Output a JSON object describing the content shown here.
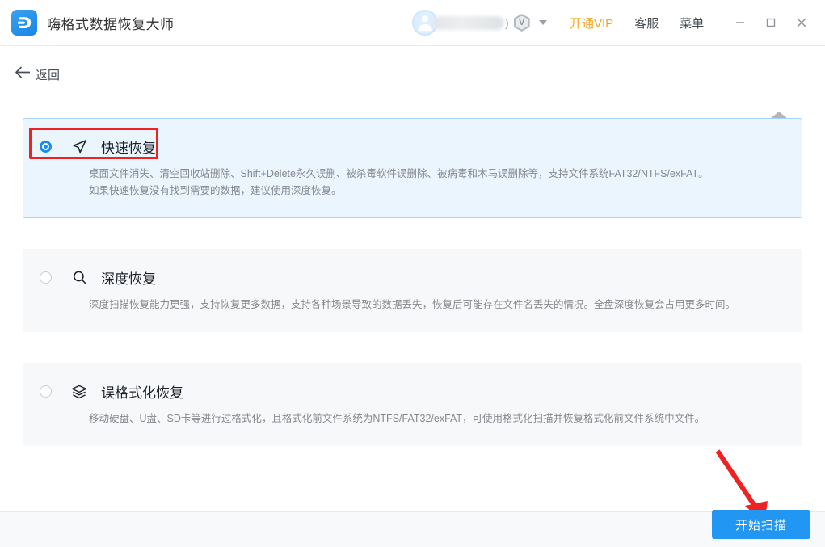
{
  "titlebar": {
    "app_title": "嗨格式数据恢复大师",
    "logo_icon": "app-logo-d-icon",
    "account": {
      "avatar_icon": "user-avatar-icon",
      "username_redacted": "",
      "paren": ")",
      "vip_badge_letter": "V",
      "dropdown_icon": "chevron-down-icon"
    },
    "links": [
      {
        "label": "开通VIP",
        "name": "open-vip-link",
        "accent": "#f5a623"
      },
      {
        "label": "客服",
        "name": "customer-service-link"
      },
      {
        "label": "菜单",
        "name": "menu-link"
      }
    ],
    "window_controls": [
      {
        "name": "minimize-button",
        "icon": "minimize-icon"
      },
      {
        "name": "maximize-button",
        "icon": "maximize-icon"
      },
      {
        "name": "close-button",
        "icon": "close-icon"
      }
    ]
  },
  "subheader": {
    "back_label": "返回",
    "back_icon": "arrow-left-icon",
    "home_icon": "home-icon"
  },
  "options": [
    {
      "id": "quick-recovery",
      "title": "快速恢复",
      "icon": "navigation-arrow-icon",
      "selected": true,
      "desc_line1": "桌面文件消失、清空回收站删除、Shift+Delete永久误删、被杀毒软件误删除、被病毒和木马误删除等，支持文件系统FAT32/NTFS/exFAT。",
      "desc_line2": "如果快速恢复没有找到需要的数据，建议使用深度恢复。"
    },
    {
      "id": "deep-recovery",
      "title": "深度恢复",
      "icon": "magnifier-icon",
      "selected": false,
      "desc_line1": "深度扫描恢复能力更强，支持恢复更多数据，支持各种场景导致的数据丢失，恢复后可能存在文件名丢失的情况。全盘深度恢复会占用更多时间。",
      "desc_line2": ""
    },
    {
      "id": "format-recovery",
      "title": "误格式化恢复",
      "icon": "layers-icon",
      "selected": false,
      "desc_line1": "移动硬盘、U盘、SD卡等进行过格式化，且格式化前文件系统为NTFS/FAT32/exFAT，可使用格式化扫描并恢复格式化前文件系统中文件。",
      "desc_line2": ""
    }
  ],
  "annotations": {
    "highlight_box_color": "#ee2222",
    "arrow_color": "#ee2222"
  },
  "footer": {
    "scan_button_label": "开始扫描",
    "scan_button_color": "#2196f3"
  }
}
